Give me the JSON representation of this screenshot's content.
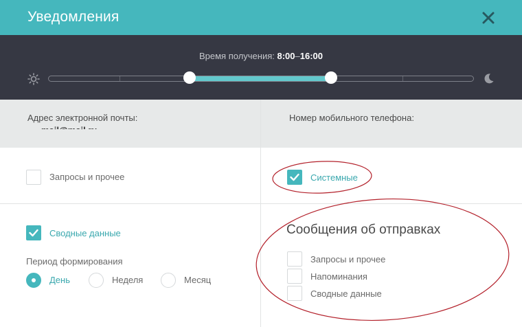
{
  "header": {
    "title": "Уведомления",
    "close_icon": "close-x-icon",
    "accent": "#45b7bd"
  },
  "time": {
    "label": "Время получения:",
    "start": "8:00",
    "separator": "–",
    "end": "16:00",
    "range_fraction": [
      0.333,
      0.667
    ],
    "day_icon": "sun-icon",
    "night_icon": "moon-icon"
  },
  "contacts": {
    "email_label": "Адрес электронной почты:",
    "email_value": "mail@mail.ru",
    "phone_label": "Номер мобильного телефона:"
  },
  "options": {
    "requests": {
      "label": "Запросы и прочее",
      "checked": false
    },
    "system": {
      "label": "Системные",
      "checked": true
    },
    "summary": {
      "label": "Сводные данные",
      "checked": true
    }
  },
  "period": {
    "label": "Период формирования",
    "options": [
      {
        "label": "День",
        "selected": true
      },
      {
        "label": "Неделя",
        "selected": false
      },
      {
        "label": "Месяц",
        "selected": false
      }
    ]
  },
  "shipments": {
    "title": "Сообщения об отправках",
    "items": [
      {
        "label": "Запросы и прочее",
        "checked": false
      },
      {
        "label": "Напоминания",
        "checked": false
      },
      {
        "label": "Сводные данные",
        "checked": false
      }
    ]
  },
  "annotation_color": "#b3202a"
}
